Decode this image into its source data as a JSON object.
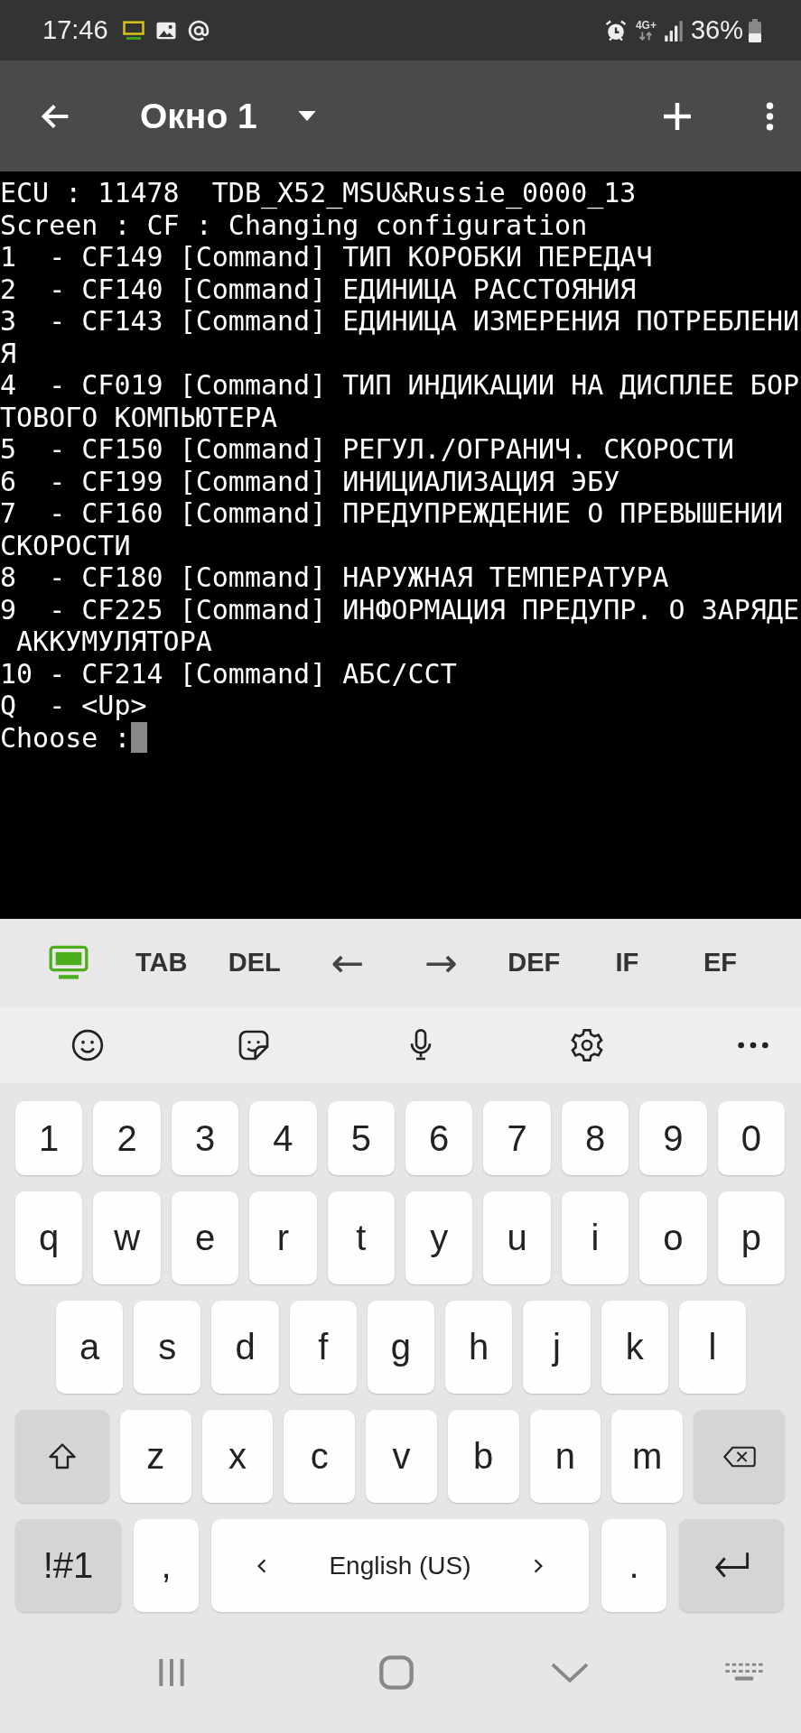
{
  "status_bar": {
    "time": "17:46",
    "network": "4G+",
    "battery": "36%"
  },
  "app_bar": {
    "title": "Окно 1"
  },
  "terminal": {
    "lines": [
      "ECU : 11478  TDB_X52_MSU&Russie_0000_13",
      "Screen : CF : Changing configuration",
      "1  - CF149 [Command] ТИП КОРОБКИ ПЕРЕДАЧ",
      "2  - CF140 [Command] ЕДИНИЦА РАССТОЯНИЯ",
      "3  - CF143 [Command] ЕДИНИЦА ИЗМЕРЕНИЯ ПОТРЕБЛЕНИ",
      "Я",
      "4  - CF019 [Command] ТИП ИНДИКАЦИИ НА ДИСПЛЕЕ БОР",
      "ТОВОГО КОМПЬЮТЕРА",
      "5  - CF150 [Command] РЕГУЛ./ОГРАНИЧ. СКОРОСТИ",
      "6  - CF199 [Command] ИНИЦИАЛИЗАЦИЯ ЭБУ",
      "7  - CF160 [Command] ПРЕДУПРЕЖДЕНИЕ О ПРЕВЫШЕНИИ",
      "СКОРОСТИ",
      "8  - CF180 [Command] НАРУЖНАЯ ТЕМПЕРАТУРА",
      "9  - CF225 [Command] ИНФОРМАЦИЯ ПРЕДУПР. О ЗАРЯДЕ",
      " АККУМУЛЯТОРА",
      "10 - CF214 [Command] АБС/ССТ",
      "Q  - <Up>"
    ],
    "prompt": "Choose :"
  },
  "extra_keys": [
    {
      "kind": "icon"
    },
    {
      "kind": "text",
      "label": "TAB"
    },
    {
      "kind": "text",
      "label": "DEL"
    },
    {
      "kind": "arrow",
      "label": "←"
    },
    {
      "kind": "arrow",
      "label": "→"
    },
    {
      "kind": "text",
      "label": "DEF"
    },
    {
      "kind": "text",
      "label": "IF"
    },
    {
      "kind": "text",
      "label": "EF"
    }
  ],
  "keyboard": {
    "rows": [
      [
        {
          "kind": "char",
          "label": "1"
        },
        {
          "kind": "char",
          "label": "2"
        },
        {
          "kind": "char",
          "label": "3"
        },
        {
          "kind": "char",
          "label": "4"
        },
        {
          "kind": "char",
          "label": "5"
        },
        {
          "kind": "char",
          "label": "6"
        },
        {
          "kind": "char",
          "label": "7"
        },
        {
          "kind": "char",
          "label": "8"
        },
        {
          "kind": "char",
          "label": "9"
        },
        {
          "kind": "char",
          "label": "0"
        }
      ],
      [
        {
          "kind": "char",
          "label": "q"
        },
        {
          "kind": "char",
          "label": "w"
        },
        {
          "kind": "char",
          "label": "e"
        },
        {
          "kind": "char",
          "label": "r"
        },
        {
          "kind": "char",
          "label": "t"
        },
        {
          "kind": "char",
          "label": "y"
        },
        {
          "kind": "char",
          "label": "u"
        },
        {
          "kind": "char",
          "label": "i"
        },
        {
          "kind": "char",
          "label": "o"
        },
        {
          "kind": "char",
          "label": "p"
        }
      ],
      [
        {
          "kind": "char",
          "label": "a"
        },
        {
          "kind": "char",
          "label": "s"
        },
        {
          "kind": "char",
          "label": "d"
        },
        {
          "kind": "char",
          "label": "f"
        },
        {
          "kind": "char",
          "label": "g"
        },
        {
          "kind": "char",
          "label": "h"
        },
        {
          "kind": "char",
          "label": "j"
        },
        {
          "kind": "char",
          "label": "k"
        },
        {
          "kind": "char",
          "label": "l"
        }
      ],
      [
        {
          "kind": "shift"
        },
        {
          "kind": "char",
          "label": "z"
        },
        {
          "kind": "char",
          "label": "x"
        },
        {
          "kind": "char",
          "label": "c"
        },
        {
          "kind": "char",
          "label": "v"
        },
        {
          "kind": "char",
          "label": "b"
        },
        {
          "kind": "char",
          "label": "n"
        },
        {
          "kind": "char",
          "label": "m"
        },
        {
          "kind": "backspace"
        }
      ]
    ],
    "function_row": {
      "symbols_key": "!#1",
      "comma_key": ",",
      "language": "English (US)",
      "period_key": "."
    }
  }
}
